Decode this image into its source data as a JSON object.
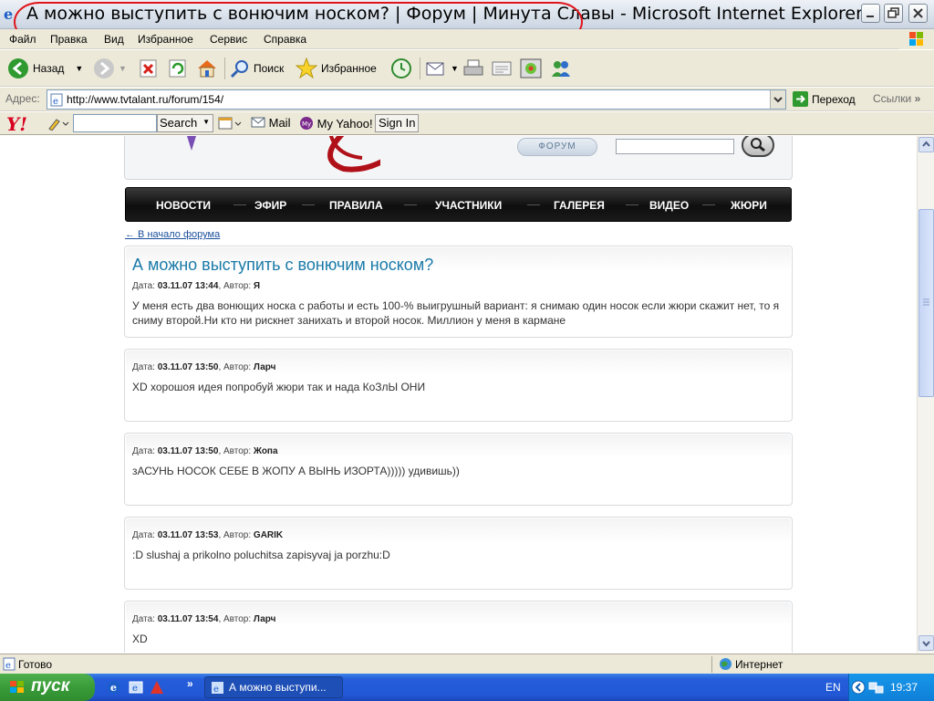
{
  "window": {
    "title": "А можно выступить с вонючим носком? | Форум | Минута Славы - Microsoft Internet Explorer"
  },
  "menu": [
    "Файл",
    "Правка",
    "Вид",
    "Избранное",
    "Сервис",
    "Справка"
  ],
  "toolbar": {
    "back": "Назад",
    "search": "Поиск",
    "favorites": "Избранное"
  },
  "address": {
    "label": "Адрес:",
    "url": "http://www.tvtalant.ru/forum/154/",
    "go": "Переход",
    "links": "Ссылки"
  },
  "yahoo": {
    "logo": "Y!",
    "search_button": "Search",
    "mail": "Mail",
    "my_yahoo": "My Yahoo!",
    "sign_in": "Sign In"
  },
  "site": {
    "forum_pill": "ФОРУМ",
    "nav": [
      "НОВОСТИ",
      "ЭФИР",
      "ПРАВИЛА",
      "УЧАСТНИКИ",
      "ГАЛЕРЕЯ",
      "ВИДЕО",
      "ЖЮРИ"
    ],
    "back_link": "← В начало форума",
    "topic_title": "А можно выступить с вонючим носком?"
  },
  "posts": [
    {
      "date_label": "Дата:",
      "date": "03.11.07 13:44",
      "author_label": ", Автор:",
      "author": "Я",
      "text": "У меня есть два вонющих носка с работы и есть 100-% выигрушный вариант: я снимаю один носок если жюри скажит нет, то я сниму второй.Ни кто ни рискнет занихать и второй носок. Миллион у меня в кармане"
    },
    {
      "date_label": "Дата:",
      "date": "03.11.07 13:50",
      "author_label": ", Автор:",
      "author": "Ларч",
      "text": "XD хорошоя идея попробуй жюри так и нада КоЗлЫ ОНИ"
    },
    {
      "date_label": "Дата:",
      "date": "03.11.07 13:50",
      "author_label": ", Автор:",
      "author": "Жопа",
      "text": "зАСУНЬ НОСОК СЕБЕ В ЖОПУ А ВЫНЬ ИЗОРТА))))) удивишь))"
    },
    {
      "date_label": "Дата:",
      "date": "03.11.07 13:53",
      "author_label": ", Автор:",
      "author": "GARIK",
      "text": ":D slushaj a prikolno poluchitsa zapisyvaj ja porzhu:D"
    },
    {
      "date_label": "Дата:",
      "date": "03.11.07 13:54",
      "author_label": ", Автор:",
      "author": "Ларч",
      "text": "XD"
    }
  ],
  "status": {
    "text": "Готово",
    "zone": "Интернет"
  },
  "taskbar": {
    "start": "пуск",
    "task": "А можно выступи...",
    "lang": "EN",
    "clock": "19:37"
  },
  "colors": {
    "annotation_oval": "#e0141b",
    "topic_title": "#1a7aa8",
    "link": "#1a4f9c",
    "taskbar": "#245edb",
    "start_button": "#3a9b39"
  }
}
